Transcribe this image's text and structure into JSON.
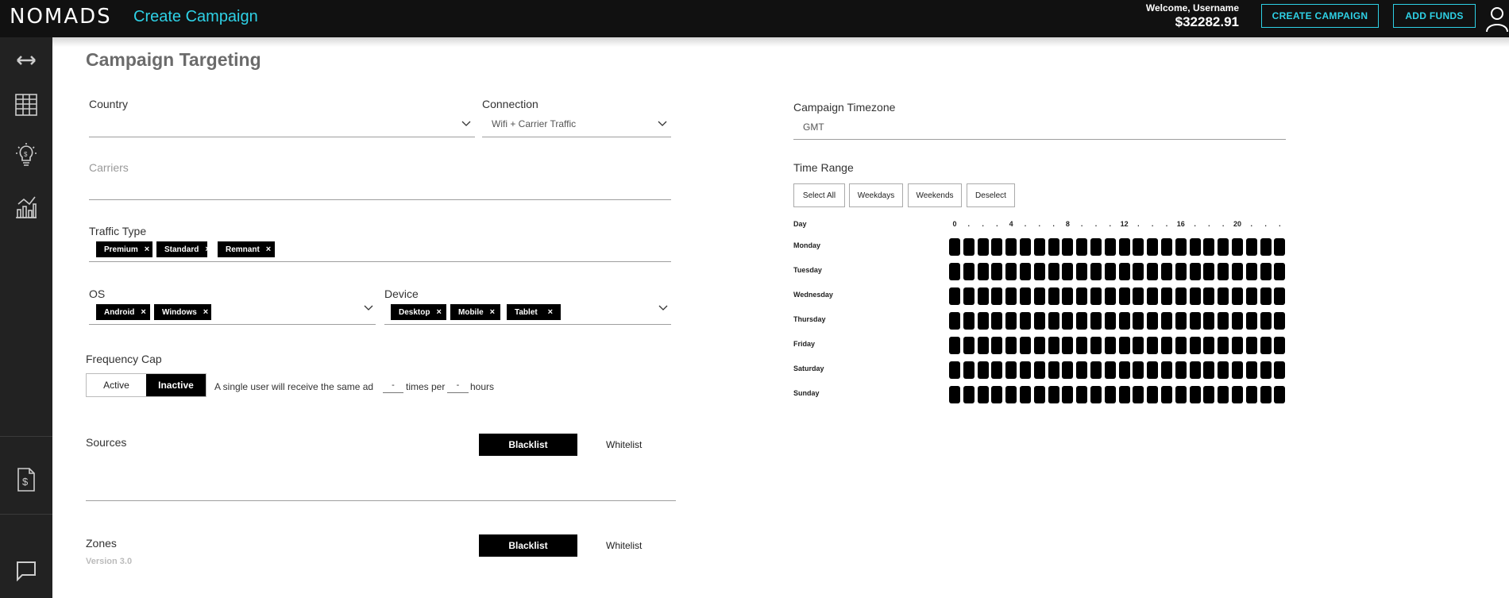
{
  "app": {
    "logo": "NOMADS",
    "page_title": "Create Campaign",
    "welcome": "Welcome, Username",
    "balance": "$32282.91",
    "create_campaign_btn": "CREATE CAMPAIGN",
    "add_funds_btn": "ADD FUNDS"
  },
  "sidebar": {
    "icons": [
      "arrows-horizontal-icon",
      "table-grid-icon",
      "lightbulb-dollar-icon",
      "analytics-chart-icon",
      "invoice-dollar-icon",
      "chat-bubble-icon"
    ]
  },
  "targeting": {
    "heading": "Campaign Targeting",
    "country_label": "Country",
    "country_value": "",
    "connection_label": "Connection",
    "connection_value": "Wifi + Carrier Traffic",
    "carriers_label": "Carriers",
    "traffic_label": "Traffic Type",
    "traffic_tags": [
      "Premium",
      "Standard",
      "Remnant"
    ],
    "os_label": "OS",
    "os_tags": [
      "Android",
      "Windows"
    ],
    "device_label": "Device",
    "device_tags": [
      "Desktop",
      "Mobile",
      "Tablet"
    ],
    "tag_remove": "×"
  },
  "frequency": {
    "label": "Frequency Cap",
    "active": "Active",
    "inactive": "Inactive",
    "selected": "Inactive",
    "text_1": "A single user will receive the same ad",
    "times_value": "-",
    "text_2": "times per",
    "hours_value": "-",
    "text_3": "hours"
  },
  "sources": {
    "label": "Sources",
    "blacklist": "Blacklist",
    "whitelist": "Whitelist"
  },
  "zones": {
    "label": "Zones",
    "blacklist": "Blacklist",
    "whitelist": "Whitelist"
  },
  "version": "Version 3.0",
  "timezone": {
    "label": "Campaign Timezone",
    "value": "GMT"
  },
  "time_range": {
    "label": "Time Range",
    "buttons": [
      "Select All",
      "Weekdays",
      "Weekends",
      "Deselect"
    ],
    "day_header": "Day",
    "hour_headers": [
      "0",
      ".",
      ".",
      ".",
      "4",
      ".",
      ".",
      ".",
      "8",
      ".",
      ".",
      ".",
      "12",
      ".",
      ".",
      ".",
      "16",
      ".",
      ".",
      ".",
      "20",
      ".",
      ".",
      "."
    ],
    "days": [
      "Monday",
      "Tuesday",
      "Wednesday",
      "Thursday",
      "Friday",
      "Saturday",
      "Sunday"
    ],
    "all_hours_selected": true
  }
}
